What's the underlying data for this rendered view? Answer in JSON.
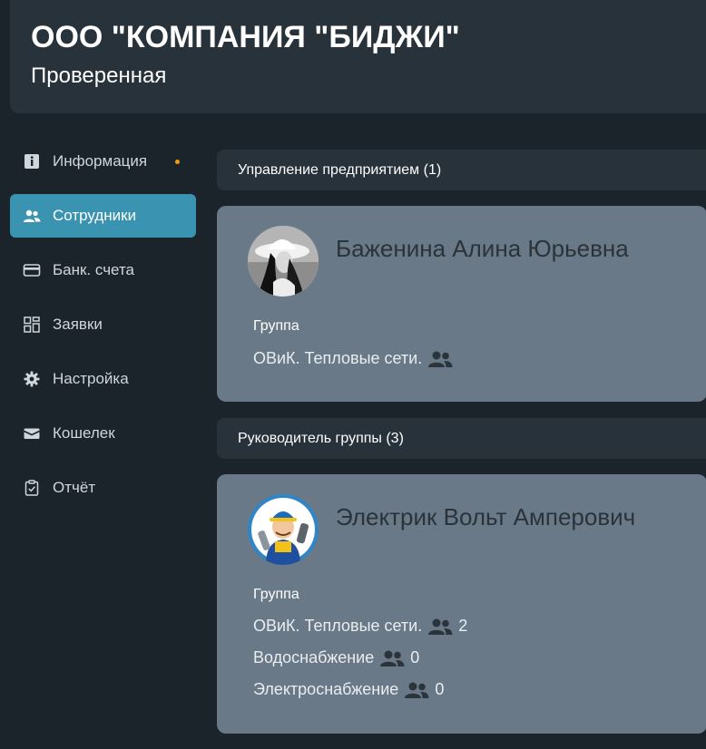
{
  "header": {
    "company": "ООО \"КОМПАНИЯ \"БИДЖИ\"",
    "status": "Проверенная"
  },
  "sidebar": {
    "items": [
      {
        "label": "Информация",
        "icon": "info-icon",
        "active": false,
        "badge_dot": true
      },
      {
        "label": "Сотрудники",
        "icon": "users-icon",
        "active": true
      },
      {
        "label": "Банк. счета",
        "icon": "card-icon",
        "active": false
      },
      {
        "label": "Заявки",
        "icon": "grid-icon",
        "active": false
      },
      {
        "label": "Настройка",
        "icon": "gear-icon",
        "active": false
      },
      {
        "label": "Кошелек",
        "icon": "wallet-icon",
        "active": false
      },
      {
        "label": "Отчёт",
        "icon": "clipboard-icon",
        "active": false
      }
    ]
  },
  "sections": [
    {
      "title": "Управление предприятием (1)",
      "employees": [
        {
          "name": "Баженина Алина Юрьевна",
          "group_label": "Группа",
          "groups": [
            {
              "name": "ОВиК. Тепловые сети.",
              "count": ""
            }
          ]
        }
      ]
    },
    {
      "title": "Руководитель группы (3)",
      "employees": [
        {
          "name": "Электрик Вольт Амперович",
          "group_label": "Группа",
          "groups": [
            {
              "name": "ОВиК. Тепловые сети.",
              "count": "2"
            },
            {
              "name": "Водоснабжение",
              "count": "0"
            },
            {
              "name": "Электроснабжение",
              "count": "0"
            }
          ]
        }
      ]
    }
  ],
  "colors": {
    "background": "#1b232b",
    "panel": "#28323b",
    "accent": "#3b93b2",
    "card": "#6a7987",
    "badge_dot": "#f39c12"
  }
}
